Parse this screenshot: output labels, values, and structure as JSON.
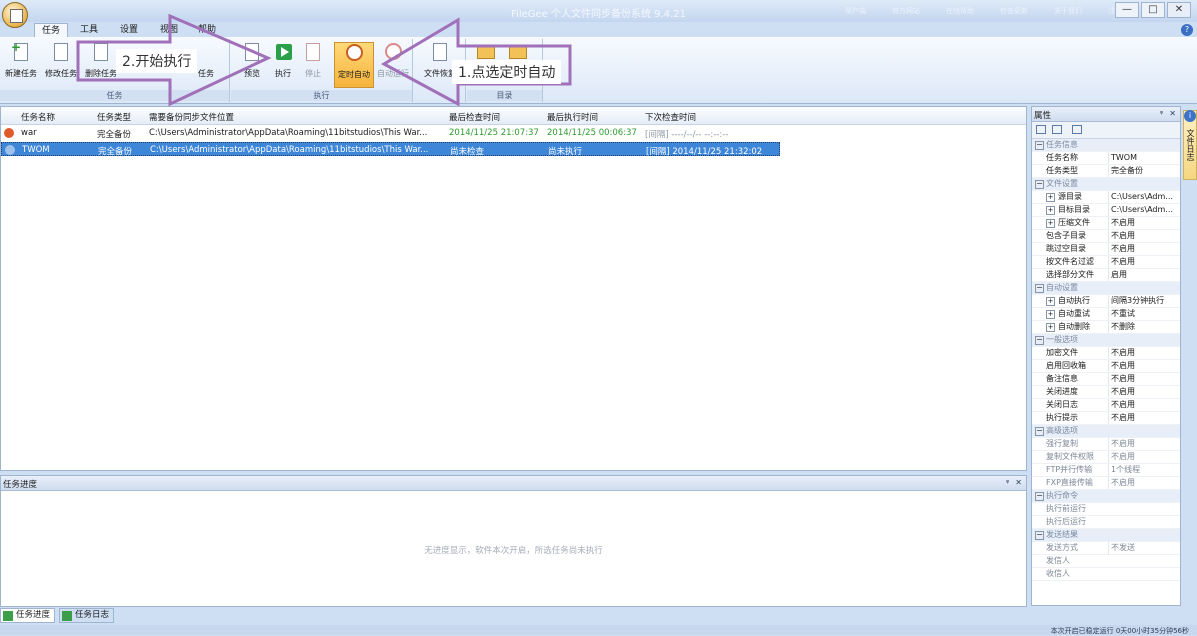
{
  "window": {
    "title": "FileGee 个人文件同步备份系统 9.4.21",
    "links": [
      "帮户端",
      "官方网站",
      "在线帮助",
      "检查更新",
      "关于我们",
      "注册软件"
    ],
    "controls": [
      "—",
      "□",
      "✕"
    ]
  },
  "ribbon_tabs": [
    "任务",
    "工具",
    "设置",
    "视图",
    "帮助"
  ],
  "ribbon": {
    "groups": [
      {
        "label": "任务",
        "buttons": [
          "新建任务",
          "修改任务",
          "删除任务",
          "",
          "任务"
        ]
      },
      {
        "label": "执行",
        "buttons": [
          "预览",
          "执行",
          "停止",
          "定时自动",
          "自动运行"
        ]
      },
      {
        "label": "",
        "buttons": [
          "文件恢复"
        ]
      },
      {
        "label": "目录",
        "buttons": []
      }
    ]
  },
  "task_table": {
    "columns": [
      "任务名称",
      "任务类型",
      "需要备份同步文件位置",
      "最后检查时间",
      "最后执行时间",
      "下次检查时间"
    ],
    "rows": [
      {
        "name": "war",
        "type": "完全备份",
        "path": "C:\\Users\\Administrator\\AppData\\Roaming\\11bitstudios\\This War...",
        "last_check": "2014/11/25 21:07:37",
        "last_exec": "2014/11/25 00:06:37",
        "next_check": "[间隔] ----/--/-- --:--:--"
      },
      {
        "name": "TWOM",
        "type": "完全备份",
        "path": "C:\\Users\\Administrator\\AppData\\Roaming\\11bitstudios\\This War...",
        "last_check": "尚未检查",
        "last_exec": "尚未执行",
        "next_check": "[间隔] 2014/11/25 21:32:02"
      }
    ]
  },
  "progress_pane": {
    "title": "任务进度",
    "empty_message": "无进度显示，软件本次开启，所选任务尚未执行"
  },
  "bottom_tabs": [
    "任务进度",
    "任务日志"
  ],
  "statusbar": {
    "text": "本次开启已稳定运行 0天00小时35分钟56秒"
  },
  "properties": {
    "title": "属性",
    "side_tab": "文件日志",
    "rows": [
      {
        "kind": "cat",
        "k": "任务信息",
        "v": ""
      },
      {
        "kind": "row",
        "k": "任务名称",
        "v": "TWOM"
      },
      {
        "kind": "row",
        "k": "任务类型",
        "v": "完全备份"
      },
      {
        "kind": "cat",
        "k": "文件设置",
        "v": ""
      },
      {
        "kind": "exp",
        "k": "源目录",
        "v": "C:\\Users\\Adm..."
      },
      {
        "kind": "exp",
        "k": "目标目录",
        "v": "C:\\Users\\Adm..."
      },
      {
        "kind": "exp",
        "k": "压缩文件",
        "v": "不启用"
      },
      {
        "kind": "row",
        "k": "包含子目录",
        "v": "不启用"
      },
      {
        "kind": "row",
        "k": "跳过空目录",
        "v": "不启用"
      },
      {
        "kind": "row",
        "k": "按文件名过滤",
        "v": "不启用"
      },
      {
        "kind": "row",
        "k": "选择部分文件",
        "v": "启用"
      },
      {
        "kind": "cat",
        "k": "自动设置",
        "v": ""
      },
      {
        "kind": "exp",
        "k": "自动执行",
        "v": "间隔3分钟执行"
      },
      {
        "kind": "exp",
        "k": "自动重试",
        "v": "不重试"
      },
      {
        "kind": "exp",
        "k": "自动删除",
        "v": "不删除"
      },
      {
        "kind": "cat",
        "k": "一般选项",
        "v": ""
      },
      {
        "kind": "row",
        "k": "加密文件",
        "v": "不启用"
      },
      {
        "kind": "row",
        "k": "启用回收箱",
        "v": "不启用"
      },
      {
        "kind": "row",
        "k": "备注信息",
        "v": "不启用"
      },
      {
        "kind": "row",
        "k": "关闭进度",
        "v": "不启用"
      },
      {
        "kind": "row",
        "k": "关闭日志",
        "v": "不启用"
      },
      {
        "kind": "row",
        "k": "执行提示",
        "v": "不启用"
      },
      {
        "kind": "cat",
        "k": "高级选项",
        "v": ""
      },
      {
        "kind": "muted",
        "k": "强行复制",
        "v": "不启用"
      },
      {
        "kind": "muted",
        "k": "复制文件权限",
        "v": "不启用"
      },
      {
        "kind": "muted",
        "k": "FTP并行传输",
        "v": "1个线程"
      },
      {
        "kind": "muted",
        "k": "FXP直接传输",
        "v": "不启用"
      },
      {
        "kind": "cat",
        "k": "执行命令",
        "v": ""
      },
      {
        "kind": "muted",
        "k": "执行前运行",
        "v": ""
      },
      {
        "kind": "muted",
        "k": "执行后运行",
        "v": ""
      },
      {
        "kind": "cat",
        "k": "发送结果",
        "v": ""
      },
      {
        "kind": "muted",
        "k": "发送方式",
        "v": "不发送"
      },
      {
        "kind": "muted",
        "k": "发信人",
        "v": ""
      },
      {
        "kind": "muted",
        "k": "收信人",
        "v": ""
      }
    ]
  },
  "annotations": {
    "step1": "1.点选定时自动",
    "step2": "2.开始执行",
    "arrow_color": "#a070b8"
  }
}
